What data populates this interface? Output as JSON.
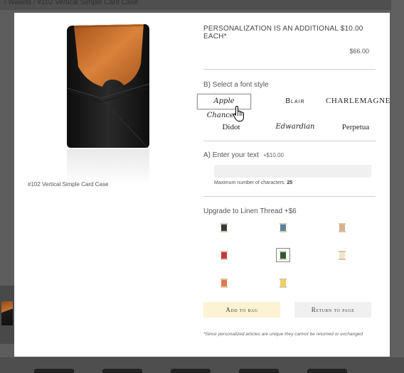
{
  "background": {
    "breadcrumb": "/ Wallets / #102 Vertical Simple Card Case"
  },
  "product": {
    "caption": "#102 Vertical Simple Card Case"
  },
  "personalization": {
    "note": "PERSONALIZATION IS AN ADDITIONAL $10.00 EACH*",
    "price": "$66.00"
  },
  "font_style": {
    "title": "B)  Select a font style",
    "options": [
      {
        "label": "Apple Chancery",
        "selected": true
      },
      {
        "label": "Blair",
        "selected": false
      },
      {
        "label": "CHARLEMAGNE",
        "selected": false
      },
      {
        "label": "Didot",
        "selected": false
      },
      {
        "label": "Edwardian",
        "selected": false
      },
      {
        "label": "Perpetua",
        "selected": false
      }
    ]
  },
  "text_entry": {
    "title": "A)  Enter your text",
    "surcharge": "+$10.00",
    "value": "",
    "max_label": "Maximum number of characters:",
    "max_value": "25"
  },
  "thread": {
    "title": "Upgrade to Linen Thread +$6",
    "spools": [
      {
        "color": "#3a3a3a",
        "selected": false
      },
      {
        "color": "#5d7f9c",
        "selected": false
      },
      {
        "color": "#d9b18a",
        "selected": false
      },
      {
        "color": "#c23a3f",
        "selected": false
      },
      {
        "color": "#2c5a34",
        "selected": true
      },
      {
        "color": "#f1e4d0",
        "selected": false
      },
      {
        "color": "#e0794e",
        "selected": false
      },
      {
        "color": "#f0cf63",
        "selected": false
      }
    ]
  },
  "buttons": {
    "add_to_bag": "Add to bag",
    "return_to_page": "Return to page"
  },
  "disclaimer": "*Since personalized articles are unique they cannot be returned or exchanged",
  "colors": {
    "add_button_bg": "#fbf3d2",
    "return_button_bg": "#f0f0f0",
    "leather_black": "#1a1a1a",
    "leather_tan": "#c26c2b"
  }
}
